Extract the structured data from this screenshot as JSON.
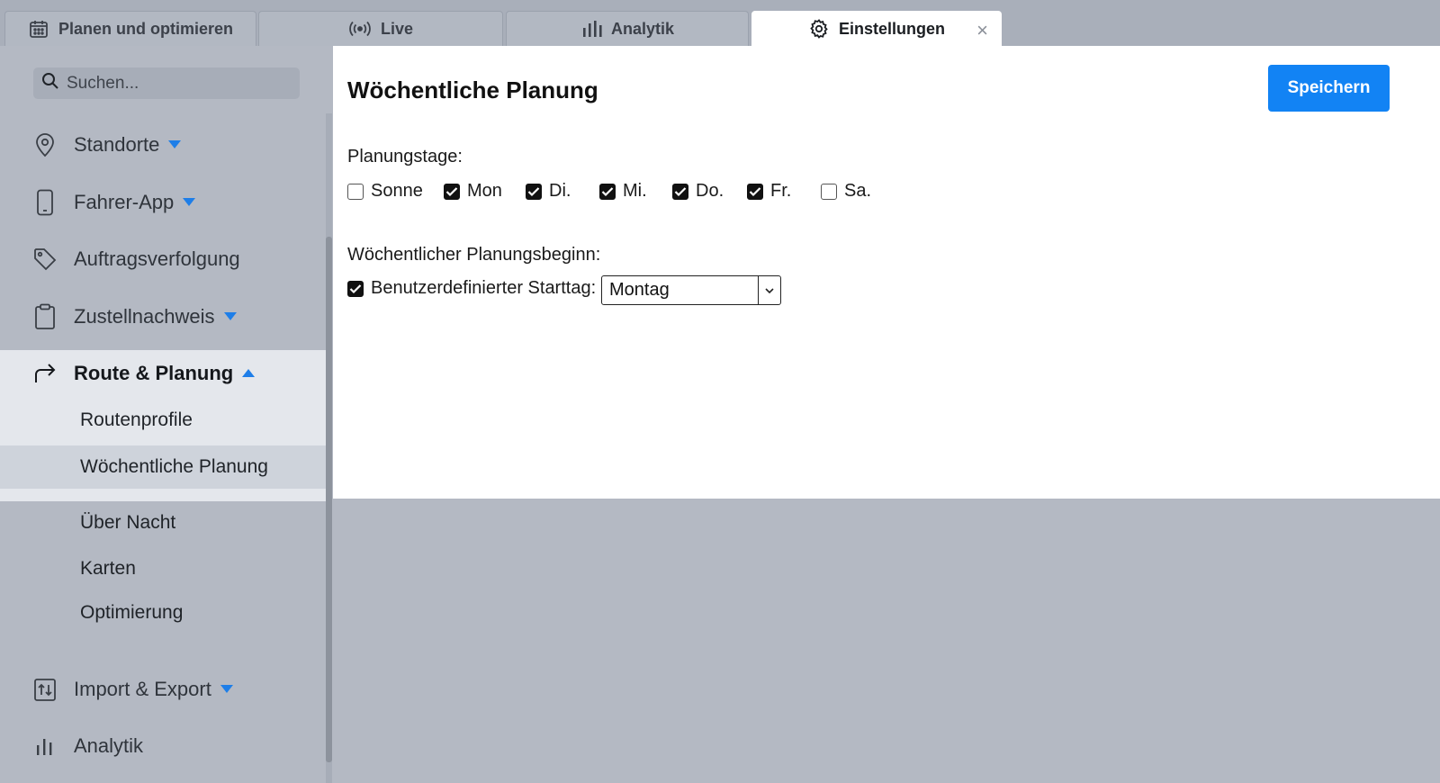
{
  "tabs": [
    {
      "label": "Planen und optimieren",
      "icon": "calendar-icon"
    },
    {
      "label": "Live",
      "icon": "broadcast-icon"
    },
    {
      "label": "Analytik",
      "icon": "bar-chart-icon"
    },
    {
      "label": "Einstellungen",
      "icon": "gear-icon",
      "active": true,
      "close": "×"
    }
  ],
  "sidebar": {
    "search_placeholder": "Suchen...",
    "items": [
      {
        "label": "Standorte",
        "icon": "location-pin-icon",
        "expandable": true
      },
      {
        "label": "Fahrer-App",
        "icon": "mobile-phone-icon",
        "expandable": true
      },
      {
        "label": "Auftragsverfolgung",
        "icon": "tag-icon",
        "expandable": false
      },
      {
        "label": "Zustellnachweis",
        "icon": "clipboard-icon",
        "expandable": true
      },
      {
        "label": "Route & Planung",
        "icon": "route-arrow-icon",
        "expanded": true
      },
      {
        "label": "Import & Export",
        "icon": "import-export-icon",
        "expandable": true
      },
      {
        "label": "Analytik",
        "icon": "bar-chart-icon",
        "expandable": false
      }
    ],
    "route_subitems": [
      {
        "label": "Routenprofile"
      },
      {
        "label": "Wöchentliche Planung",
        "selected": true
      },
      {
        "label": "Über Nacht"
      },
      {
        "label": "Karten"
      },
      {
        "label": "Optimierung"
      }
    ]
  },
  "main": {
    "title": "Wöchentliche Planung",
    "save_label": "Speichern",
    "planning_days_label": "Planungstage:",
    "days": [
      {
        "label": "Sonne",
        "checked": false
      },
      {
        "label": "Mon",
        "checked": true
      },
      {
        "label": "Di.",
        "checked": true
      },
      {
        "label": "Mi.",
        "checked": true
      },
      {
        "label": "Do.",
        "checked": true
      },
      {
        "label": "Fr.",
        "checked": true
      },
      {
        "label": "Sa.",
        "checked": false
      }
    ],
    "week_start_label": "Wöchentlicher Planungsbeginn:",
    "custom_start_label": "Benutzerdefinierter Starttag:",
    "custom_start_checked": true,
    "start_day_value": "Montag"
  },
  "colors": {
    "accent": "#1283f4",
    "caret": "#1e7ee8",
    "sidebar_bg": "#b4b9c3",
    "selected_bg": "#ced3db"
  }
}
